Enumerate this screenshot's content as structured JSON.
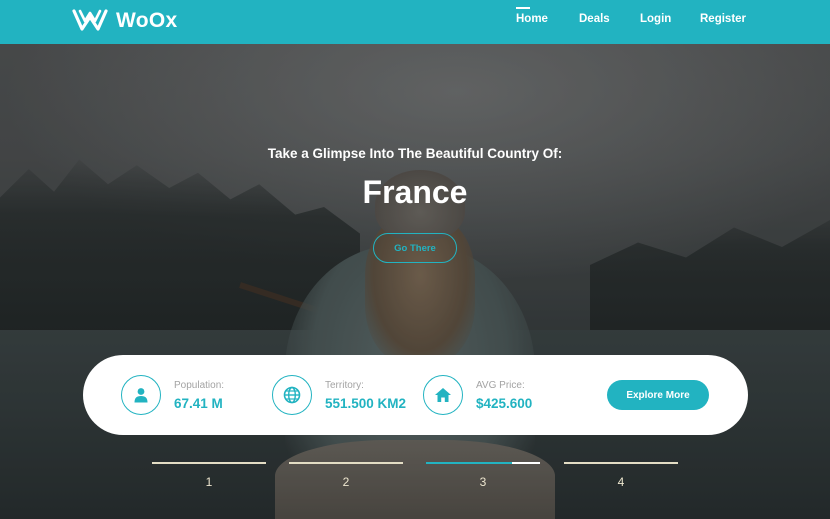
{
  "navbar": {
    "brand": "WoOx",
    "logo_icon": "double-w-logo-icon",
    "items": [
      {
        "label": "Home",
        "active": true
      },
      {
        "label": "Deals",
        "active": false
      },
      {
        "label": "Login",
        "active": false
      },
      {
        "label": "Register",
        "active": false
      }
    ]
  },
  "hero": {
    "subtitle": "Take a Glimpse Into The Beautiful Country Of:",
    "country": "France",
    "cta_label": "Go There"
  },
  "info": {
    "stats": [
      {
        "icon": "user-icon",
        "label": "Population:",
        "value": "67.41 M"
      },
      {
        "icon": "globe-icon",
        "label": "Territory:",
        "value": "551.500 KM2"
      },
      {
        "icon": "home-icon",
        "label": "AVG Price:",
        "value": "$425.600"
      }
    ],
    "explore_label": "Explore More"
  },
  "slider": {
    "tabs": [
      "1",
      "2",
      "3",
      "4"
    ],
    "active_index": 2,
    "active_progress": 0.75
  },
  "colors": {
    "accent": "#22b3c1",
    "card": "#ffffff",
    "muted_text": "#a3a3a3",
    "tab_text": "#ede6cf"
  }
}
